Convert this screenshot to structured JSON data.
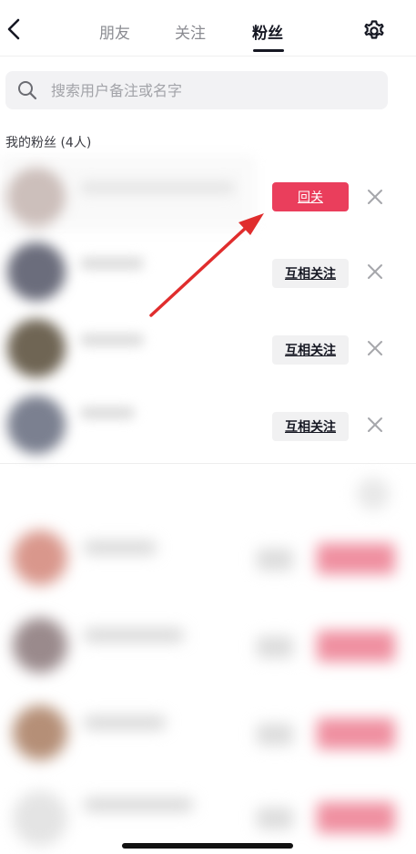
{
  "header": {
    "tabs": [
      {
        "label": "朋友",
        "active": false
      },
      {
        "label": "关注",
        "active": false
      },
      {
        "label": "粉丝",
        "active": true
      }
    ],
    "back_icon": "chevron-left-icon",
    "settings_icon": "gear-icon"
  },
  "search": {
    "placeholder": "搜索用户备注或名字",
    "value": ""
  },
  "fans": {
    "title": "我的粉丝 (4人)",
    "rows": [
      {
        "action_label": "回关",
        "action_type": "follow-back",
        "highlighted": true
      },
      {
        "action_label": "互相关注",
        "action_type": "mutual"
      },
      {
        "action_label": "互相关注",
        "action_type": "mutual"
      },
      {
        "action_label": "互相关注",
        "action_type": "mutual"
      }
    ]
  },
  "colors": {
    "accent": "#ea3e5c",
    "annotation_arrow": "#e02d2d",
    "secondary_button": "#f1f1f2",
    "text_primary": "#161823",
    "text_secondary": "#8a8b91"
  }
}
